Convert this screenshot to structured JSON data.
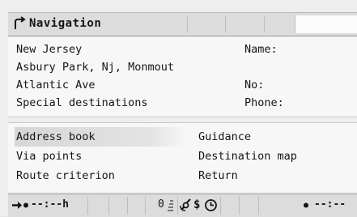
{
  "header": {
    "title": "Navigation",
    "icon": "navigation-arrow-icon"
  },
  "destination": {
    "state": "New Jersey",
    "city": "Asbury Park, Nj, Monmout",
    "street": "Atlantic Ave",
    "special": "Special destinations",
    "name_label": "Name:",
    "no_label": "No:",
    "phone_label": "Phone:"
  },
  "menu": {
    "address_book": "Address book",
    "guidance": "Guidance",
    "via_points": "Via points",
    "destination_map": "Destination map",
    "route_criterion": "Route criterion",
    "return": "Return"
  },
  "status": {
    "arrival_time": "--:--h",
    "counter": "0",
    "clock_time": "--:--"
  }
}
